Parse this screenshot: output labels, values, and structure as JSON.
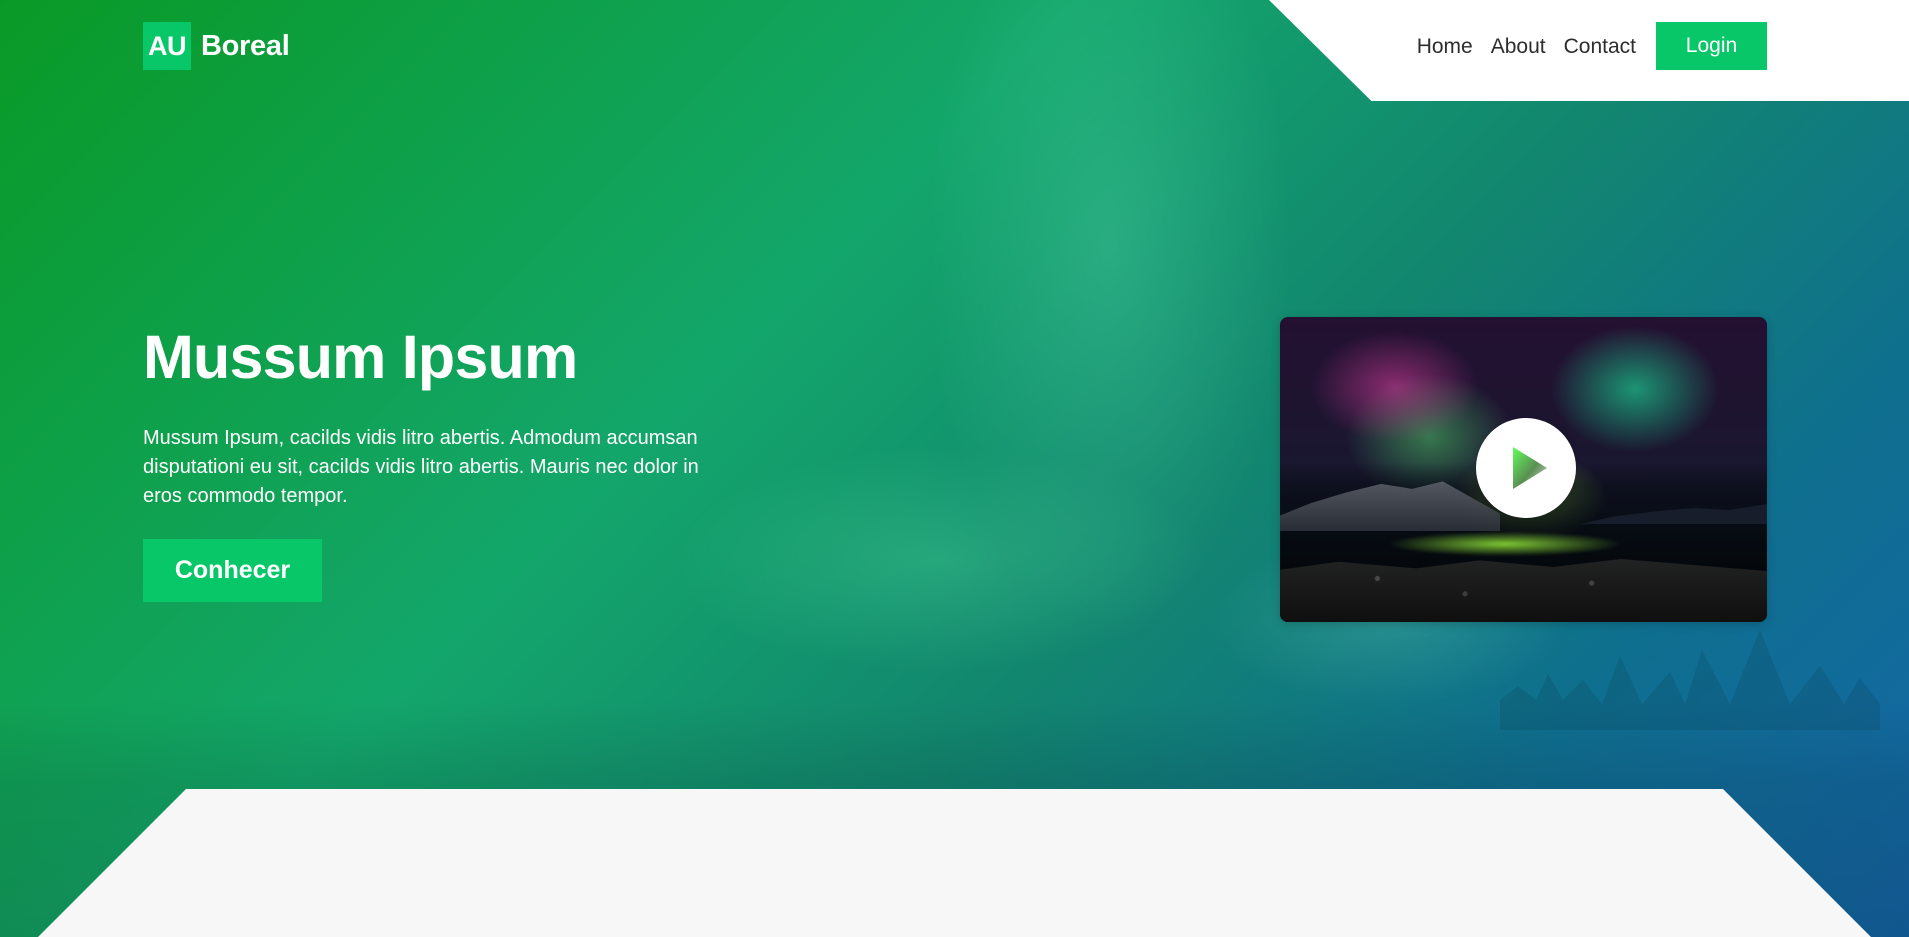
{
  "brand": {
    "mark": "AU",
    "name": "Boreal"
  },
  "navigation": {
    "items": [
      {
        "label": "Home"
      },
      {
        "label": "About"
      },
      {
        "label": "Contact"
      }
    ],
    "login_label": "Login"
  },
  "hero": {
    "title": "Mussum Ipsum",
    "description": "Mussum Ipsum, cacilds vidis litro abertis. Admodum accumsan disputationi eu sit, cacilds vidis litro abertis. Mauris nec dolor in eros commodo tempor.",
    "cta_label": "Conhecer"
  },
  "media": {
    "play_icon": "play-icon"
  },
  "colors": {
    "brand_green": "#07c768",
    "hero_green": "#099a26",
    "hero_blue": "#1466a8",
    "panel_white": "#ffffff",
    "bottom_panel": "#f7f7f7"
  }
}
